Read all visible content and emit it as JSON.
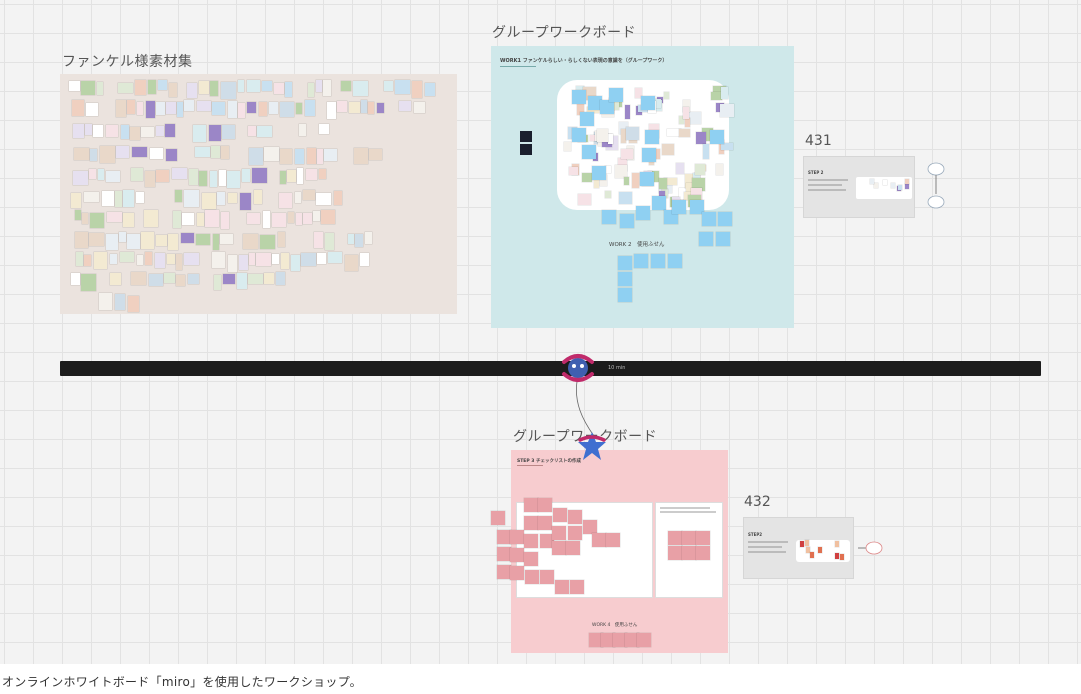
{
  "board": {
    "frame1_title": "ファンケル様素材集",
    "frame2_title": "グループワークボード",
    "frame2_heading": "WORK1 ファンケルらしい・らしくない表現の意識を（グループワーク）",
    "frame2_work2": "WORK 2　使用ふせん",
    "frame2_num": "431",
    "frame2_step": "STEP 2",
    "timer_text": "10 min",
    "frame3_title": "グループワークボード",
    "frame3_heading": "STEP 3 チェックリストの作成",
    "frame3_work4": "WORK 4　使用ふせん",
    "frame3_num": "432",
    "frame3_step": "STEP2",
    "colors": {
      "frame1_bg": "#ebe3de",
      "frame2_bg": "#cfe8ea",
      "frame3_bg": "#f7cccf",
      "sticky_blue": "#8fd0f2",
      "sticky_pink": "#e8a0a6",
      "timer_bar": "#1c1c1c"
    }
  },
  "caption": "オンラインホワイトボード「miro」を使用したワークショップ。"
}
